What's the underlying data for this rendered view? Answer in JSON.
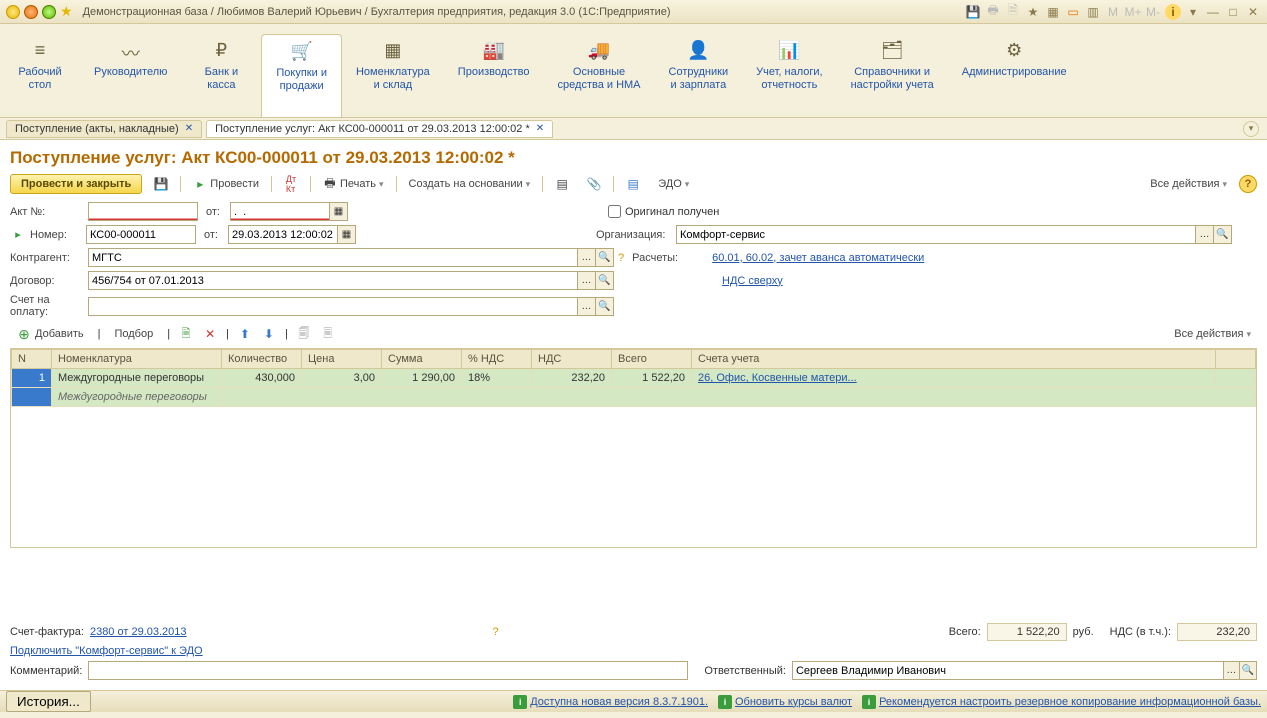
{
  "titlebar": {
    "title": "Демонстрационная база / Любимов Валерий Юрьевич / Бухгалтерия предприятия, редакция 3.0  (1С:Предприятие)",
    "m_labels": [
      "M",
      "M+",
      "M-"
    ]
  },
  "maintabs": [
    {
      "label": "Рабочий\nстол",
      "glyph": "≡"
    },
    {
      "label": "Руководителю",
      "glyph": "〰"
    },
    {
      "label": "Банк и\nкасса",
      "glyph": "₽"
    },
    {
      "label": "Покупки и\nпродажи",
      "glyph": "🛒"
    },
    {
      "label": "Номенклатура\nи склад",
      "glyph": "▦"
    },
    {
      "label": "Производство",
      "glyph": "🏭"
    },
    {
      "label": "Основные\nсредства и НМА",
      "glyph": "🚚"
    },
    {
      "label": "Сотрудники\nи зарплата",
      "glyph": "👤"
    },
    {
      "label": "Учет, налоги,\nотчетность",
      "glyph": "📊"
    },
    {
      "label": "Справочники и\nнастройки учета",
      "glyph": "🗂"
    },
    {
      "label": "Администрирование",
      "glyph": "⚙"
    }
  ],
  "tabs": [
    {
      "label": "Поступление (акты, накладные)",
      "active": false
    },
    {
      "label": "Поступление услуг: Акт КС00-000011 от 29.03.2013 12:00:02 *",
      "active": true
    }
  ],
  "page": {
    "title": "Поступление услуг: Акт КС00-000011 от 29.03.2013 12:00:02 *"
  },
  "toolbar": {
    "main_btn": "Провести и закрыть",
    "post": "Провести",
    "print": "Печать",
    "create_based": "Создать на основании",
    "edo": "ЭДО",
    "all_actions": "Все действия"
  },
  "form": {
    "act_no_label": "Акт №:",
    "act_from_label": "от:",
    "act_date_value": ".  .",
    "number_label": "Номер:",
    "number_value": "КС00-000011",
    "date_label": "от:",
    "date_value": "29.03.2013 12:00:02",
    "counterparty_label": "Контрагент:",
    "counterparty_value": "МГТС",
    "contract_label": "Договор:",
    "contract_value": "456/754 от 07.01.2013",
    "invoice_label": "Счет на оплату:",
    "invoice_value": "",
    "original_label": "Оригинал получен",
    "org_label": "Организация:",
    "org_value": "Комфорт-сервис",
    "settlements_label": "Расчеты:",
    "settlements_value": "60.01, 60.02, зачет аванса автоматически",
    "vat_mode": "НДС сверху"
  },
  "grid_tools": {
    "add": "Добавить",
    "pick": "Подбор",
    "all_actions": "Все действия"
  },
  "grid": {
    "headers": [
      "N",
      "Номенклатура",
      "Количество",
      "Цена",
      "Сумма",
      "% НДС",
      "НДС",
      "Всего",
      "Счета учета"
    ],
    "row": {
      "n": "1",
      "nomen": "Междугородные переговоры",
      "nomen_sub": "Междугородные переговоры",
      "qty": "430,000",
      "price": "3,00",
      "sum": "1 290,00",
      "vat_pct": "18%",
      "vat": "232,20",
      "total": "1 522,20",
      "accounts": "26, Офис, Косвенные матери..."
    }
  },
  "footer": {
    "invoice_factura_label": "Счет-фактура:",
    "invoice_factura_link": "2380 от 29.03.2013",
    "edo_connect": "Подключить \"Комфорт-сервис\" к ЭДО",
    "total_label": "Всего:",
    "total_value": "1 522,20",
    "rub": "руб.",
    "vat_label": "НДС (в т.ч.):",
    "vat_value": "232,20",
    "comment_label": "Комментарий:",
    "comment_value": "",
    "responsible_label": "Ответственный:",
    "responsible_value": "Сергеев Владимир Иванович"
  },
  "statusbar": {
    "history": "История...",
    "version": "Доступна новая версия 8.3.7.1901.",
    "currency": "Обновить курсы валют",
    "backup": "Рекомендуется настроить резервное копирование информационной базы."
  }
}
